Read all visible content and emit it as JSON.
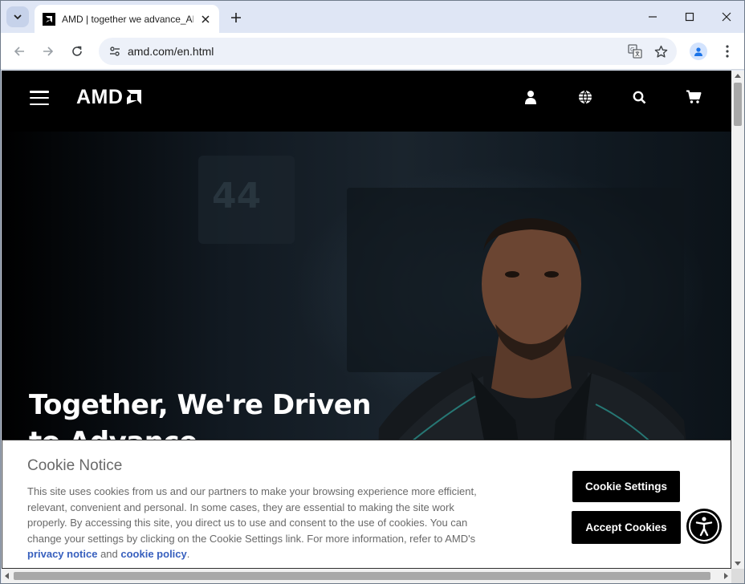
{
  "browser": {
    "tab_title": "AMD | together we advance_AI",
    "url": "amd.com/en.html",
    "colors": {
      "chrome_bg": "#dfe6f5",
      "omnibox_bg": "#edf1f9"
    }
  },
  "site": {
    "logo_text": "AMD",
    "header_icons": [
      "user-icon",
      "globe-icon",
      "search-icon",
      "cart-icon"
    ],
    "hero": {
      "title": "Together, We're Driven to Advance"
    }
  },
  "cookie_notice": {
    "title": "Cookie Notice",
    "body": "This site uses cookies from us and our partners to make your browsing experience more efficient, relevant, convenient and personal. In some cases, they are essential to making the site work properly. By accessing this site, you direct us to use and consent to the use of cookies. You can change your settings by clicking on the Cookie Settings link. For more information, refer to AMD's",
    "privacy_link": "privacy notice",
    "and_text": "and",
    "cookie_link": "cookie policy",
    "end": ".",
    "settings_button": "Cookie Settings",
    "accept_button": "Accept Cookies",
    "link_color": "#3860be"
  }
}
